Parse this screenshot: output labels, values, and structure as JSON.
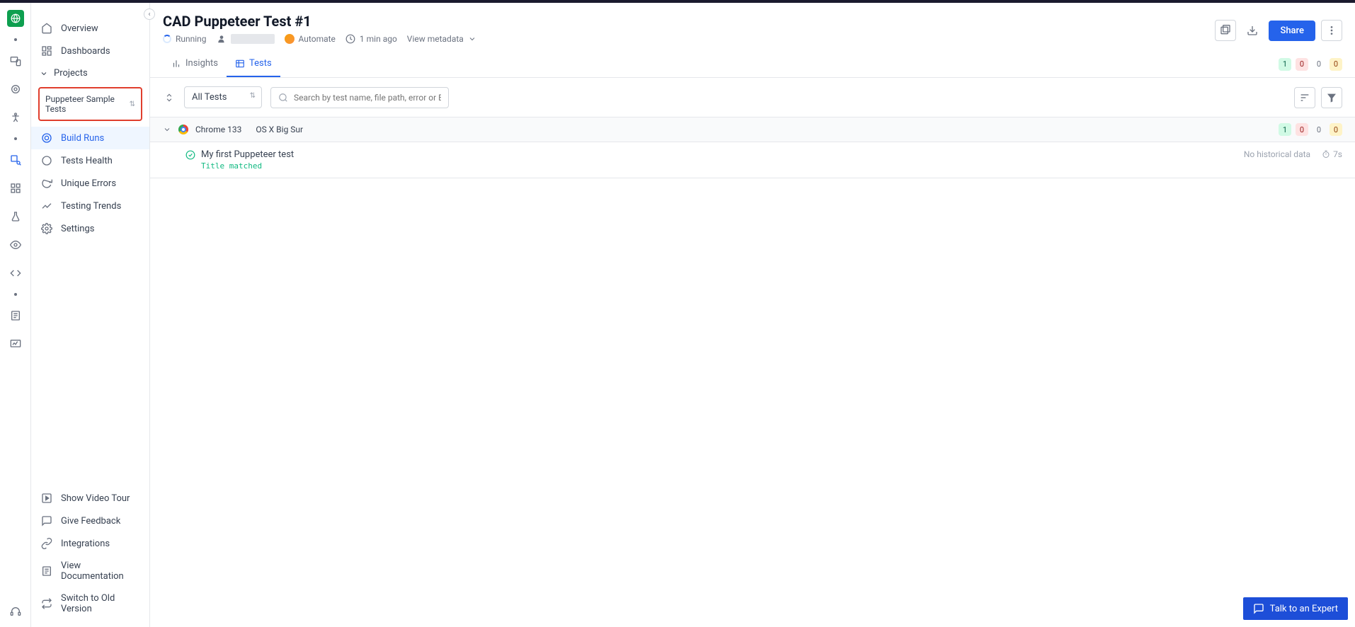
{
  "sidebar": {
    "overview": "Overview",
    "dashboards": "Dashboards",
    "projects": "Projects",
    "project_selected": "Puppeteer Sample Tests",
    "nav": {
      "build_runs": "Build Runs",
      "tests_health": "Tests Health",
      "unique_errors": "Unique Errors",
      "testing_trends": "Testing Trends",
      "settings": "Settings"
    },
    "bottom": {
      "video_tour": "Show Video Tour",
      "feedback": "Give Feedback",
      "integrations": "Integrations",
      "docs": "View Documentation",
      "old_version": "Switch to Old Version"
    }
  },
  "header": {
    "title": "CAD Puppeteer Test #1",
    "status": "Running",
    "automate": "Automate",
    "time_ago": "1 min ago",
    "view_metadata": "View metadata",
    "share": "Share"
  },
  "tabs": {
    "insights": "Insights",
    "tests": "Tests"
  },
  "summary": {
    "passed": "1",
    "failed": "0",
    "skipped": "0",
    "pending": "0"
  },
  "filters": {
    "all_tests": "All Tests",
    "search_placeholder": "Search by test name, file path, error or BrowserSt"
  },
  "group": {
    "browser": "Chrome 133",
    "os": "OS X Big Sur",
    "passed": "1",
    "failed": "0",
    "skipped": "0",
    "pending": "0"
  },
  "test": {
    "name": "My first Puppeteer test",
    "subtitle": "Title matched",
    "historical": "No historical data",
    "duration": "7s"
  },
  "expert_btn": "Talk to an Expert"
}
